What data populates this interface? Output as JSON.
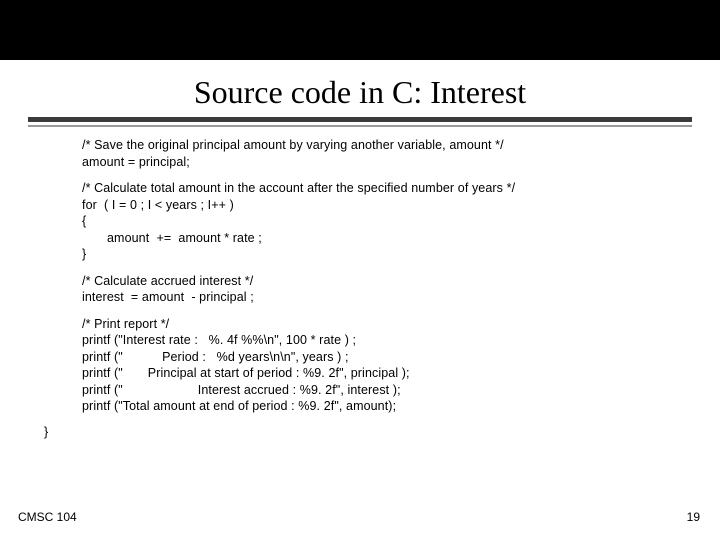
{
  "title": "Source code in C: Interest",
  "code": {
    "block1": "/* Save the original principal amount by varying another variable, amount */\namount = principal;",
    "block2": "/* Calculate total amount in the account after the specified number of years */\nfor  ( I = 0 ; I < years ; I++ )\n{\n       amount  +=  amount * rate ;\n}",
    "block3": "/* Calculate accrued interest */\ninterest  = amount  - principal ;",
    "block4": "/* Print report */\nprintf (\"Interest rate :   %. 4f %%\\n\", 100 * rate ) ;\nprintf (\"           Period :   %d years\\n\\n\", years ) ;\nprintf (\"       Principal at start of period : %9. 2f\", principal );\nprintf (\"                     Interest accrued : %9. 2f\", interest );\nprintf (\"Total amount at end of period : %9. 2f\", amount);"
  },
  "closebrace": "}",
  "footer": {
    "left": "CMSC 104",
    "right": "19"
  }
}
